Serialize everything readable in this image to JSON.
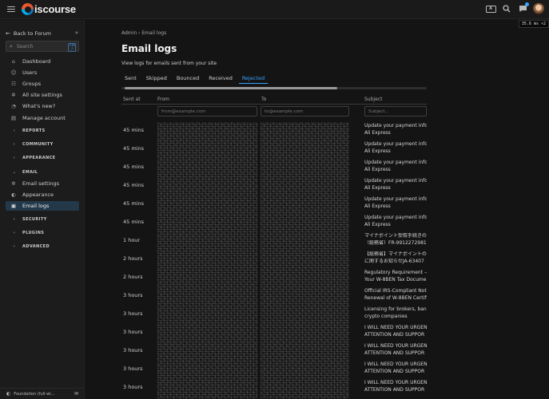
{
  "header": {
    "logo_text": "iscourse",
    "kbd_badge": "A",
    "perf": "35.6 ms ×2"
  },
  "sidebar": {
    "back_label": "Back to Forum",
    "search_placeholder": "Search",
    "search_kbd": "Ctrl /",
    "items": [
      {
        "label": "Dashboard",
        "icon": "home-icon"
      },
      {
        "label": "Users",
        "icon": "users-icon"
      },
      {
        "label": "Groups",
        "icon": "groups-icon"
      },
      {
        "label": "All site settings",
        "icon": "gear-icon"
      },
      {
        "label": "What's new?",
        "icon": "bell-icon"
      },
      {
        "label": "Manage account",
        "icon": "id-card-icon"
      }
    ],
    "sections": [
      "REPORTS",
      "COMMUNITY",
      "APPEARANCE",
      "EMAIL",
      "SECURITY",
      "PLUGINS",
      "ADVANCED"
    ],
    "email_items": [
      {
        "label": "Email settings",
        "icon": "gear-icon"
      },
      {
        "label": "Appearance",
        "icon": "palette-icon"
      },
      {
        "label": "Email logs",
        "icon": "list-icon",
        "active": true
      }
    ],
    "footer_label": "Foundation (full-wi..."
  },
  "main": {
    "breadcrumb": {
      "root": "Admin",
      "sep": "›",
      "current": "Email logs"
    },
    "title": "Email logs",
    "subtitle": "View logs for emails sent from your site",
    "tabs": [
      "Sent",
      "Skipped",
      "Bounced",
      "Received",
      "Rejected"
    ],
    "active_tab": "Rejected",
    "columns": {
      "sent_at": "Sent at",
      "from": "From",
      "to": "To",
      "subject": "Subject"
    },
    "filters": {
      "from": "from@example.com",
      "to": "to@example.com",
      "subject": "Subject..."
    },
    "rows": [
      {
        "time": "45 mins",
        "subject": [
          "Update your payment infon",
          "Ali Express"
        ]
      },
      {
        "time": "45 mins",
        "subject": [
          "Update your payment infon",
          "Ali Express"
        ]
      },
      {
        "time": "45 mins",
        "subject": [
          "Update your payment infon",
          "Ali Express"
        ]
      },
      {
        "time": "45 mins",
        "subject": [
          "Update your payment infon",
          "Ali Express"
        ]
      },
      {
        "time": "45 mins",
        "subject": [
          "Update your payment infon",
          "Ali Express"
        ]
      },
      {
        "time": "45 mins",
        "subject": [
          "Update your payment infon",
          "Ali Express"
        ]
      },
      {
        "time": "1 hour",
        "subject": [
          "マイナポイント受取手続きの",
          "（総務省）FR-9912272981"
        ]
      },
      {
        "time": "2 hours",
        "subject": [
          "【総務省】マイナポイントの",
          "に関するお知らせJA-63407"
        ]
      },
      {
        "time": "2 hours",
        "subject": [
          "Regulatory Requirement —",
          "Your W-8BEN Tax Docume"
        ]
      },
      {
        "time": "3 hours",
        "subject": [
          "Official IRS-Compliant Noti",
          "Renewal of W-8BEN Certifi"
        ]
      },
      {
        "time": "3 hours",
        "subject": [
          "Licensing for brokers, bank",
          "crypto companies"
        ]
      },
      {
        "time": "3 hours",
        "subject": [
          "I WILL NEED YOUR URGEN",
          "ATTENTION AND SUPPOR"
        ]
      },
      {
        "time": "3 hours",
        "subject": [
          "I WILL NEED YOUR URGEN",
          "ATTENTION AND SUPPOR"
        ]
      },
      {
        "time": "3 hours",
        "subject": [
          "I WILL NEED YOUR URGEN",
          "ATTENTION AND SUPPOR"
        ]
      },
      {
        "time": "3 hours",
        "subject": [
          "I WILL NEED YOUR URGEN",
          "ATTENTION AND SUPPOR"
        ]
      }
    ]
  },
  "colors": {
    "accent": "#3aa4ff",
    "background": "#141414",
    "sidebar_active": "#23394a"
  }
}
